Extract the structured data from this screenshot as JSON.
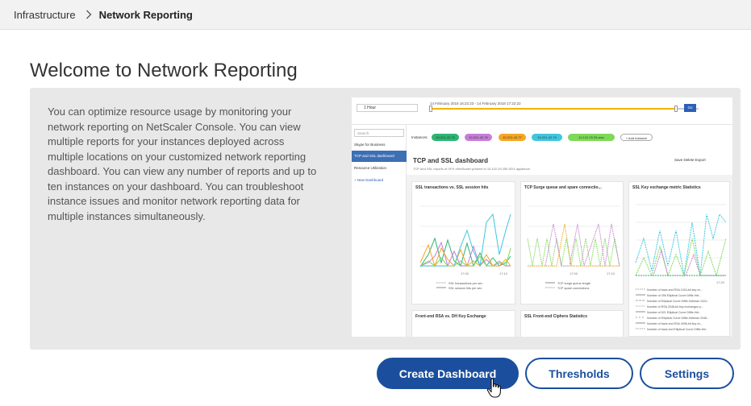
{
  "breadcrumb": {
    "parent": "Infrastructure",
    "current": "Network Reporting"
  },
  "page": {
    "title": "Welcome to Network Reporting",
    "description": "You can optimize resource usage by monitoring your network reporting on NetScaler Console. You can view multiple reports for your instances deployed across multiple locations on your customized network reporting dashboard. You can view any number of reports and up to ten instances on your dashboard. You can troubleshoot instance issues and monitor network reporting data for multiple instances simultaneously."
  },
  "preview": {
    "time_select": "1 Hour",
    "time_range": "14 February 2018 16:22:23 - 14 February 2018 17:22:22",
    "go_label": "Go",
    "search_placeholder": "Search",
    "nav_items": [
      "Skype for Business",
      "TCP and SSL dashboard",
      "Resource Utilization",
      "+ New Dashboard"
    ],
    "instances_label": "Instances:",
    "instances": [
      {
        "label": "10.221.42.75",
        "color": "#2bb673"
      },
      {
        "label": "10.221.42.76",
        "color": "#c77dd8"
      },
      {
        "label": "10.221.42.77",
        "color": "#f5a623"
      },
      {
        "label": "10.221.42.78",
        "color": "#3ec7e0"
      },
      {
        "label": "10.102.29.35-aws",
        "color": "#7ed957"
      }
    ],
    "add_label": "+ Add Instance",
    "dashboard_title": "TCP and SSL dashboard",
    "dashboard_sub": "TCP and SSL reports of VPX vNetScaler present in 10.102.29.255 SDX appliance",
    "actions": "Save  Delete  Export",
    "charts": [
      {
        "title": "SSL transactions vs. SSL session hits",
        "legend": [
          "SSL transactions per sec",
          "SSL session hits per sec"
        ]
      },
      {
        "title": "TCP Surge queue and spare connectio...",
        "legend": [
          "TCP surge queue length",
          "TCP spare connections"
        ]
      },
      {
        "title": "SSL Key exchange metric Statistics",
        "legend": [
          "Number of back-end RSA 1024-bit key ex...",
          "Number of 256 Elliptical Curve Diffie-Hel...",
          "Number of Elliptical Curve Diffie-Hellman 1024...",
          "Number of RSA 2048-bit key exchanges p...",
          "Number of 521 Elliptical Curve Diffie-Hel...",
          "Number of Elliptical Curve Diffie-Hellman 2048...",
          "Number of back-end RSA 4096-bit key ex...",
          "Number of back-end Elliptical Curve Diffie-Hel..."
        ]
      },
      {
        "title": "Front-end RSA vs. DH Key Exchange",
        "legend": []
      },
      {
        "title": "SSL Front-end Ciphers Statistics",
        "legend": []
      }
    ]
  },
  "buttons": {
    "create": "Create Dashboard",
    "thresholds": "Thresholds",
    "settings": "Settings"
  },
  "colors": {
    "primary": "#1b4f9e",
    "panel_bg": "#e8e8e8",
    "breadcrumb_bg": "#f2f2f2"
  }
}
